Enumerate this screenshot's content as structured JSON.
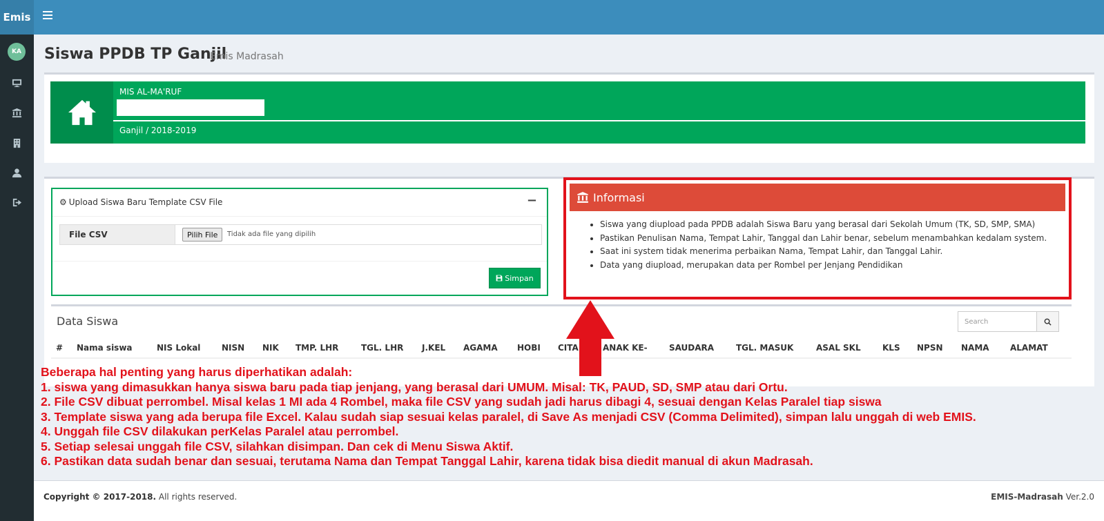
{
  "brand": "Emis",
  "user": {
    "initials": "KA"
  },
  "page": {
    "title": "Siswa PPDB TP Ganjil",
    "subtitle": "Emis Madrasah"
  },
  "school": {
    "name": "MIS AL-MA'RUF",
    "period": "Ganjil / 2018-2019"
  },
  "upload": {
    "title": "Upload Siswa Baru Template CSV File",
    "collapse": "−",
    "file_label": "File CSV",
    "choose_button": "Pilih File",
    "file_status": "Tidak ada file yang dipilih",
    "save_button": "Simpan"
  },
  "info": {
    "title": "Informasi",
    "items": [
      "Siswa yang diupload pada PPDB adalah Siswa Baru yang berasal dari Sekolah Umum (TK, SD, SMP, SMA)",
      "Pastikan Penulisan Nama, Tempat Lahir, Tanggal dan Lahir benar, sebelum menambahkan kedalam system.",
      "Saat ini system tidak menerima perbaikan Nama, Tempat Lahir, dan Tanggal Lahir.",
      "Data yang diupload, merupakan data per Rombel per Jenjang Pendidikan"
    ]
  },
  "data_siswa": {
    "title": "Data Siswa",
    "search_placeholder": "Search",
    "columns": [
      "#",
      "Nama siswa",
      "NIS Lokal",
      "NISN",
      "NIK",
      "TMP. LHR",
      "TGL. LHR",
      "J.KEL",
      "AGAMA",
      "HOBI",
      "CITA",
      "ANAK KE-",
      "SAUDARA",
      "TGL. MASUK",
      "ASAL SKL",
      "KLS",
      "NPSN",
      "NAMA",
      "ALAMAT"
    ]
  },
  "notes": [
    "Beberapa hal penting yang harus diperhatikan adalah:",
    "1. siswa yang dimasukkan hanya siswa baru pada tiap jenjang, yang berasal dari UMUM. Misal: TK, PAUD, SD, SMP atau dari Ortu.",
    "2. File CSV dibuat perrombel. Misal kelas 1 MI ada 4 Rombel, maka file CSV yang sudah jadi harus dibagi 4, sesuai dengan Kelas Paralel tiap siswa",
    "3. Template siswa yang ada berupa file Excel. Kalau sudah siap sesuai kelas paralel, di Save As menjadi CSV (Comma Delimited), simpan lalu unggah di web EMIS.",
    "4. Unggah file CSV dilakukan perKelas Paralel atau perrombel.",
    "5. Setiap selesai unggah file CSV, silahkan disimpan. Dan cek di Menu Siswa Aktif.",
    "6. Pastikan data sudah benar dan sesuai, terutama Nama dan Tempat Tanggal Lahir, karena tidak bisa diedit manual di akun Madrasah."
  ],
  "footer": {
    "copyright": "Copyright © 2017-2018.",
    "rights": " All rights reserved.",
    "app": "EMIS-Madrasah",
    "version": " Ver.2.0"
  },
  "colors": {
    "topbar": "#3c8dbc",
    "sidebar": "#222d32",
    "success": "#00a65a",
    "danger": "#dd4b39",
    "annotation": "#e2121b"
  },
  "icons": [
    "menu-icon",
    "monitor-icon",
    "institution-icon",
    "building-icon",
    "user-icon",
    "sign-out-icon",
    "home-icon",
    "cogs-icon",
    "save-icon",
    "search-icon",
    "up-arrow-icon"
  ]
}
